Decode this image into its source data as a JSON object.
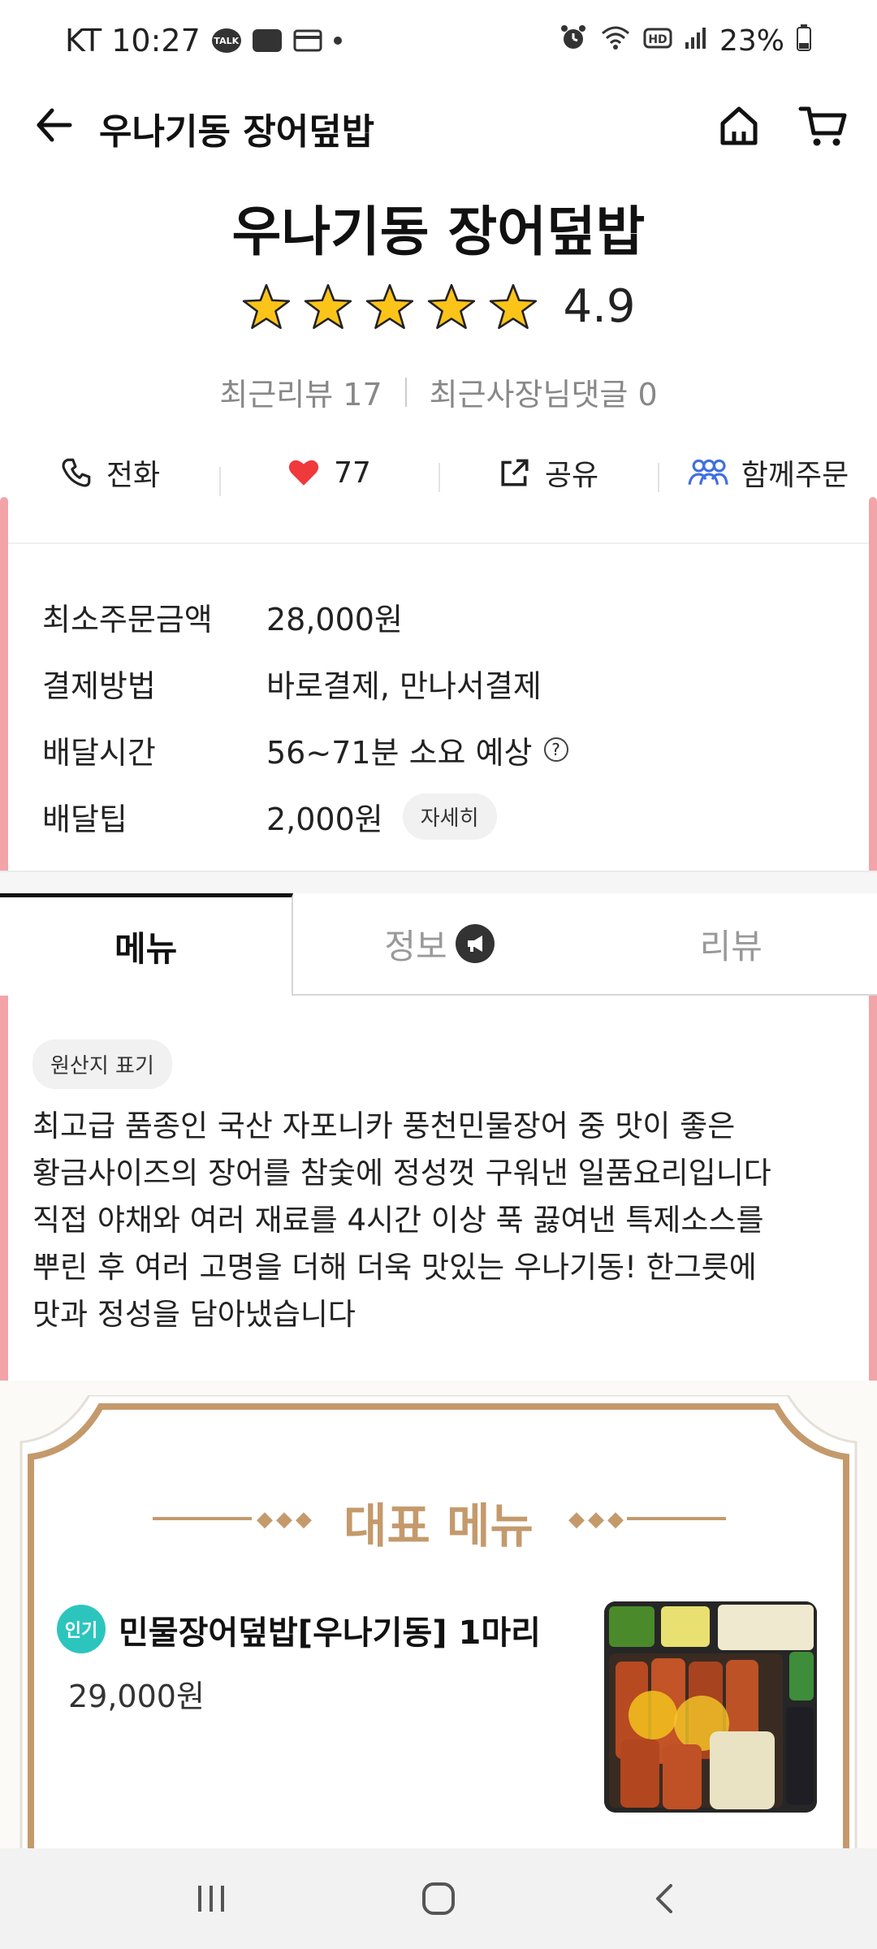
{
  "status_bar": {
    "carrier_time": "KT 10:27",
    "talk_label": "TALK",
    "battery": "23%"
  },
  "app_bar": {
    "title": "우나기동 장어덮밥"
  },
  "store": {
    "name": "우나기동 장어덮밥",
    "rating": "4.9",
    "rating_stars": 5,
    "recent_reviews": "최근리뷰 17",
    "owner_replies": "최근사장님댓글 0"
  },
  "actions": {
    "call": "전화",
    "likes": "77",
    "share": "공유",
    "group_order": "함께주문"
  },
  "info": [
    {
      "label": "최소주문금액",
      "value": "28,000원"
    },
    {
      "label": "결제방법",
      "value": "바로결제, 만나서결제"
    },
    {
      "label": "배달시간",
      "value": "56~71분 소요 예상"
    },
    {
      "label": "배달팁",
      "value": "2,000원",
      "detail": "자세히"
    }
  ],
  "tabs": {
    "menu": "메뉴",
    "info": "정보",
    "review": "리뷰"
  },
  "origin_chip": "원산지 표기",
  "description": "최고급 품종인 국산 자포니카 풍천민물장어 중 맛이 좋은\n황금사이즈의 장어를 참숯에 정성껏 구워낸 일품요리입니다\n직접 야채와 여러 재료를 4시간 이상 푹 끓여낸 특제소스를\n뿌린 후 여러 고명을 더해 더욱 맛있는 우나기동! 한그릇에\n맛과 정성을 담아냈습니다",
  "signature": {
    "title": "대표 메뉴",
    "item": {
      "badge": "인기",
      "name": "민물장어덮밥[우나기동] 1마리",
      "price": "29,000원"
    }
  },
  "colors": {
    "accent_gold": "#c49a6c",
    "badge_teal": "#2cc5be",
    "heart_red": "#f0393d",
    "group_blue": "#3f6fe0"
  }
}
